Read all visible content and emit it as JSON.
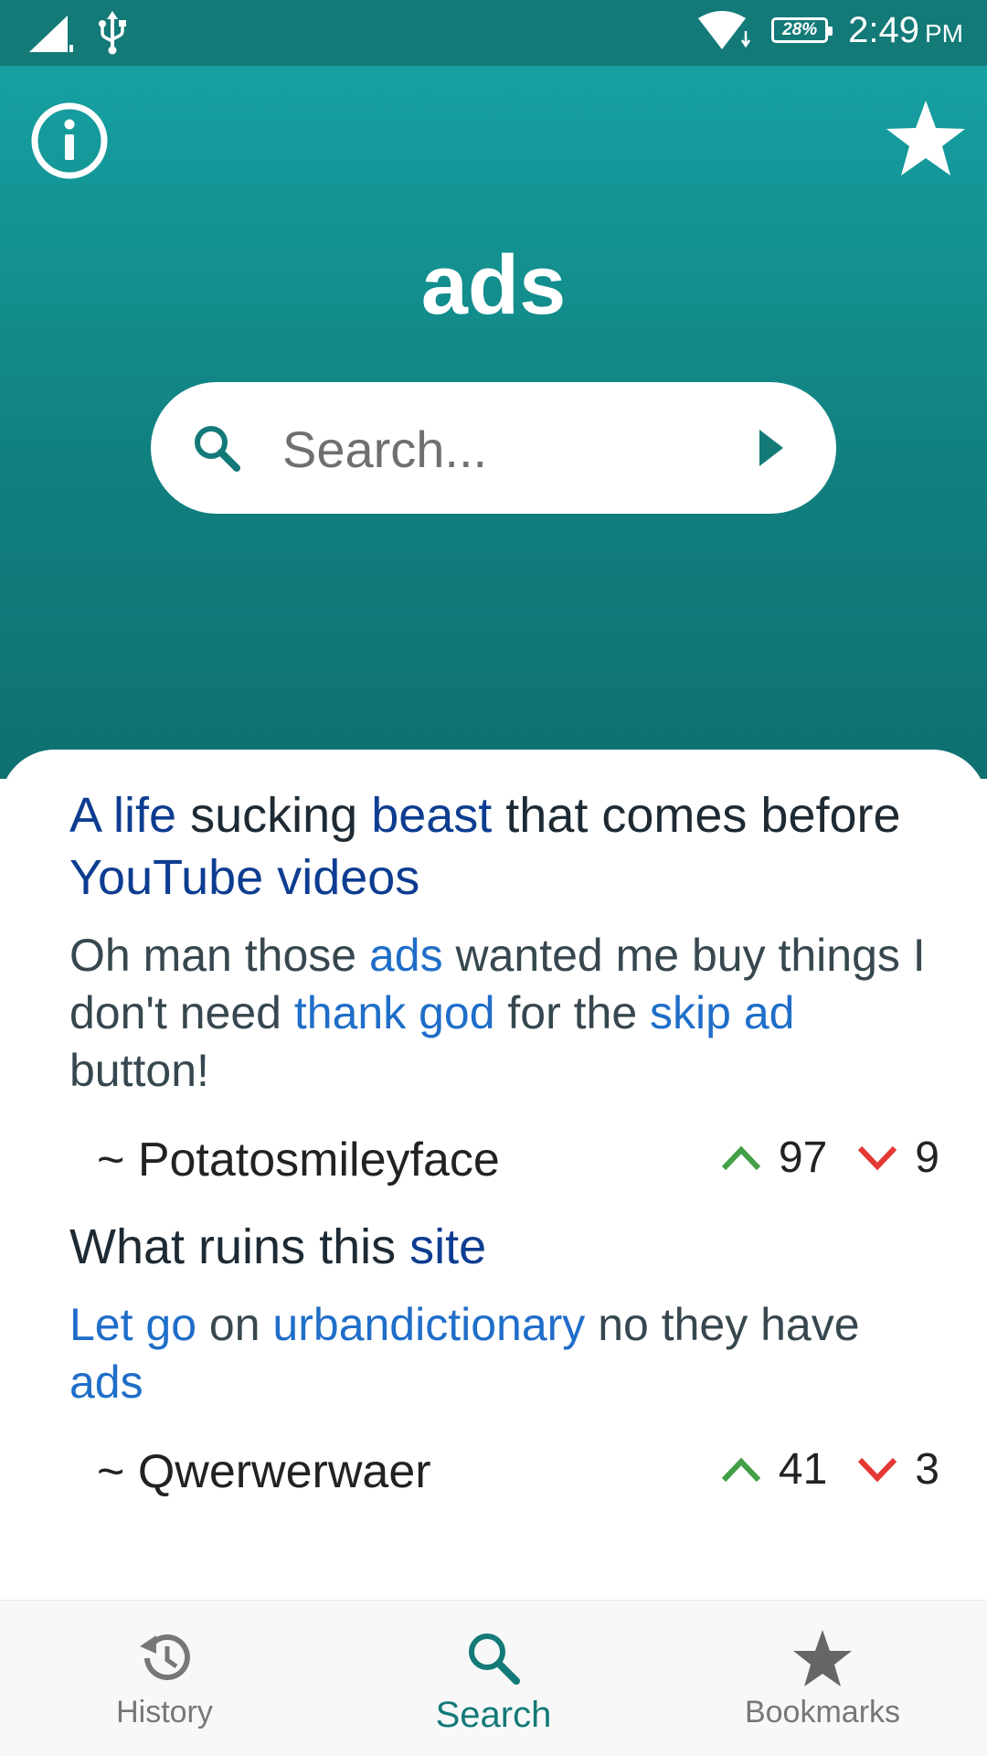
{
  "status_bar": {
    "battery": "28%",
    "time": "2:49",
    "ampm": "PM"
  },
  "header": {
    "title": "ads"
  },
  "search": {
    "placeholder": "Search..."
  },
  "colors": {
    "accent": "#137a78",
    "keyword_title": "#0d3d91",
    "keyword_body": "#1f6ec9",
    "upvote": "#43a047",
    "downvote": "#e53935"
  },
  "entries": [
    {
      "title": [
        "A life",
        " sucking ",
        "beast",
        " that comes before ",
        "YouTube videos"
      ],
      "body": [
        "Oh man those ",
        "ads",
        " wanted me buy things I don't need ",
        "thank god",
        " for the ",
        "skip ad",
        " button!"
      ],
      "author": "~ Potatosmileyface",
      "upvotes": "97",
      "downvotes": "9"
    },
    {
      "title": [
        "What ruins this ",
        "site"
      ],
      "body": [
        "Let go",
        " on ",
        "urbandictionary",
        " no they have ",
        "ads"
      ],
      "author": "~ Qwerwerwaer",
      "upvotes": "41",
      "downvotes": "3"
    }
  ],
  "bottom_nav": {
    "history": "History",
    "search": "Search",
    "bookmarks": "Bookmarks"
  }
}
